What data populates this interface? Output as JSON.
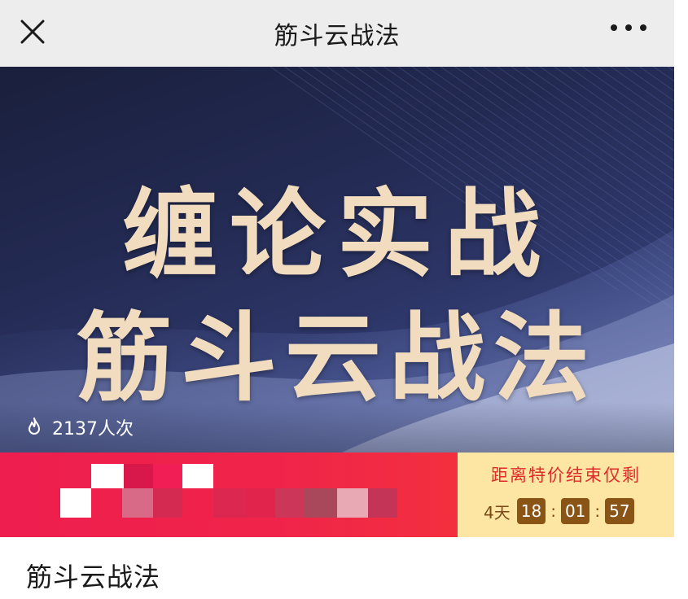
{
  "navbar": {
    "title": "筋斗云战法",
    "close_icon": "close-icon",
    "more_icon": "more-icon"
  },
  "banner": {
    "line1": "缠论实战",
    "line2": "筋斗云战法",
    "views_icon": "fire-icon",
    "views_text": "2137人次"
  },
  "promo": {
    "label": "距离特价结束仅剩",
    "days": "4天",
    "hours": "18",
    "minutes": "01",
    "seconds": "57",
    "sep": ":",
    "colors": {
      "left": "#f0244a",
      "right": "#fde6a4",
      "timer": "#8a5416"
    }
  },
  "course": {
    "title": "筋斗云战法"
  }
}
